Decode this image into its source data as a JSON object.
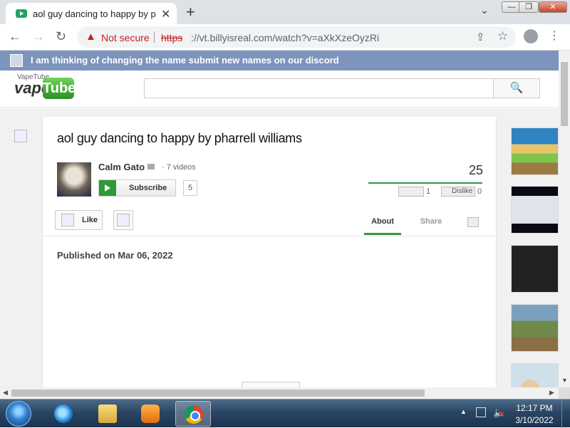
{
  "browser": {
    "tab_title": "aol guy dancing to happy by pharrell williams",
    "tab_close": "✕",
    "new_tab": "+",
    "tab_search": "⌄",
    "window_minimize": "—",
    "window_restore": "❐",
    "window_close": "✕",
    "back": "←",
    "forward": "→",
    "reload": "↻",
    "warning_icon": "▲",
    "not_secure": "Not secure",
    "url_scheme": "https",
    "url_rest": "://vt.billyisreal.com/watch?v=aXkXzeOyzRi",
    "share_icon": "⇪",
    "star_icon": "☆",
    "menu_icon": "⋮"
  },
  "banner": {
    "text": "I am thinking of changing the name submit new names on our discord"
  },
  "masthead": {
    "logo_alt": "VapeTube",
    "logo_vape": "vape",
    "logo_tube": "Tube",
    "search_icon": "🔍"
  },
  "video": {
    "title": "aol guy dancing to happy by pharrell williams",
    "channel_name": "Calm Gato",
    "video_count": "· 7 videos",
    "subscribe_label": "Subscribe",
    "subscriber_count": "5",
    "view_count": "25",
    "like_count": "1",
    "dislike_label": "Dislike",
    "dislike_count": "0",
    "like_button_label": "Like",
    "published": "Published on Mar 06, 2022"
  },
  "tabs": {
    "about": "About",
    "share": "Share"
  },
  "taskbar": {
    "tray_up": "▲",
    "volume_icon": "🔈",
    "volume_mute": "✕",
    "clock_time": "12:17 PM",
    "clock_date": "3/10/2022"
  },
  "scrollbars": {
    "up": "▲",
    "down": "▼",
    "left": "◀",
    "right": "▶"
  },
  "colors": {
    "banner_bg": "#7d94bd",
    "accent_green": "#2f9a36",
    "not_secure_red": "#c5221f"
  }
}
